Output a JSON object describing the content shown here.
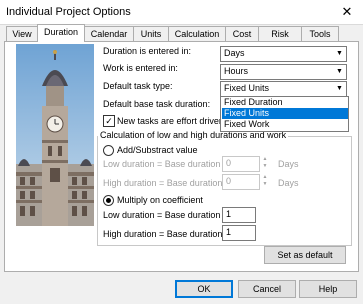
{
  "window": {
    "title": "Individual Project Options",
    "close_glyph": "✕"
  },
  "tabs": [
    {
      "label": "View"
    },
    {
      "label": "Duration"
    },
    {
      "label": "Calendar"
    },
    {
      "label": "Units"
    },
    {
      "label": "Calculation"
    },
    {
      "label": "Cost"
    },
    {
      "label": "Risk"
    },
    {
      "label": "Tools"
    }
  ],
  "active_tab": "Duration",
  "fields": {
    "duration_entered": {
      "label": "Duration is entered in:",
      "value": "Days"
    },
    "work_entered": {
      "label": "Work is entered in:",
      "value": "Hours"
    },
    "task_type": {
      "label": "Default task type:",
      "value": "Fixed Units"
    },
    "base_duration": {
      "label": "Default base task duration:"
    },
    "effort_driven": {
      "label": "New tasks are effort driven",
      "checked": true,
      "check_glyph": "✓"
    }
  },
  "task_type_options": [
    {
      "label": "Fixed Duration",
      "selected": false
    },
    {
      "label": "Fixed Units",
      "selected": true
    },
    {
      "label": "Fixed Work",
      "selected": false
    }
  ],
  "calc_group": {
    "title": "Calculation of low and high durations and work",
    "add_sub": {
      "label": "Add/Substract value",
      "selected": false
    },
    "low_add": {
      "label": "Low duration = Base duration -",
      "value": "0",
      "unit": "Days"
    },
    "high_add": {
      "label": "High duration = Base duration +",
      "value": "0",
      "unit": "Days"
    },
    "multiply": {
      "label": "Multiply on coefficient",
      "selected": true
    },
    "low_mul": {
      "label": "Low duration = Base duration *",
      "value": "1"
    },
    "high_mul": {
      "label": "High duration = Base duration *",
      "value": "1"
    }
  },
  "buttons": {
    "set_default": "Set as default",
    "ok": "OK",
    "cancel": "Cancel",
    "help": "Help"
  },
  "icons": {
    "dropdown_arrow": "▼",
    "spin_up": "▲",
    "spin_down": "▼"
  },
  "colors": {
    "selection": "#0078d7",
    "dialog_bg": "#f0f0f0"
  }
}
